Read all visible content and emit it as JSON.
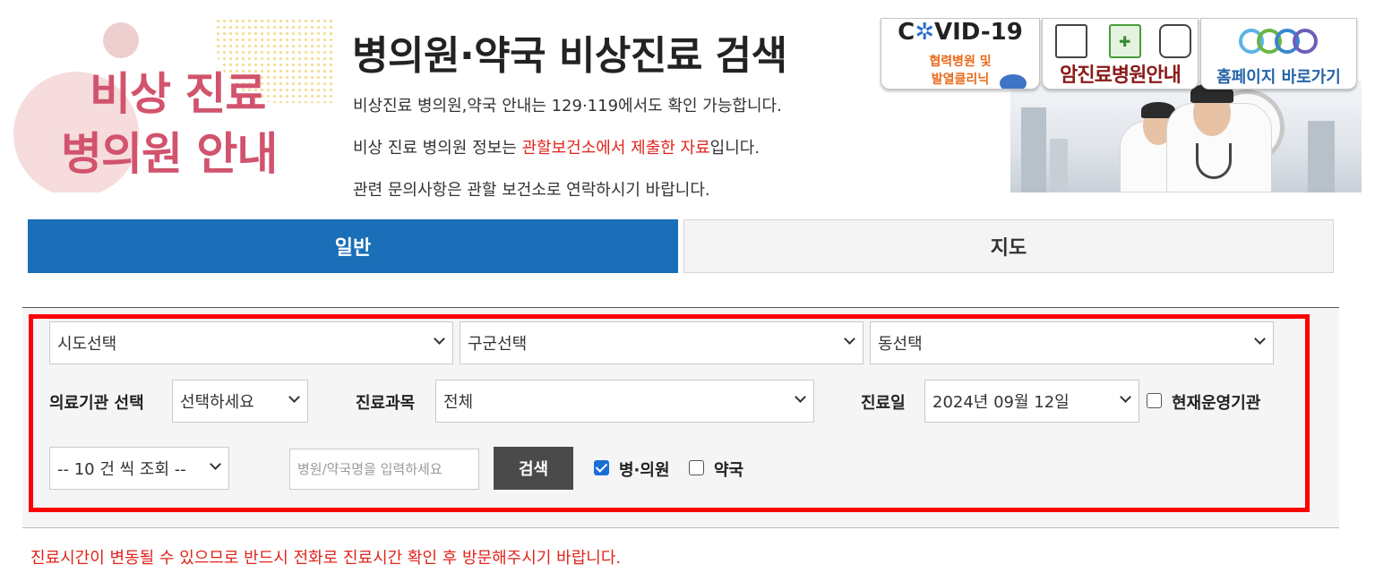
{
  "header": {
    "logo_line1": "비상 진료",
    "logo_line2": "병의원 안내",
    "title": "병의원·약국 비상진료 검색",
    "info1": "비상진료 병의원,약국 안내는 129·119에서도 확인 가능합니다.",
    "info2_prefix": "비상 진료 병의원 정보는 ",
    "info2_highlight": "관할보건소에서 제출한 자료",
    "info2_suffix": "입니다.",
    "info3": "관련 문의사항은 관할 보건소로 연락하시기 바랍니다."
  },
  "banner": {
    "covid_title_c": "C",
    "covid_title_virus": "✲",
    "covid_title_rest": "VID-19",
    "covid_sub1": "협력병원 및",
    "covid_sub2": "발열클리닉",
    "cancer_label": "암진료병원안내",
    "home_label": "홈페이지 바로가기"
  },
  "tabs": [
    {
      "label": "일반",
      "active": true
    },
    {
      "label": "지도",
      "active": false
    }
  ],
  "filters": {
    "sido": "시도선택",
    "gugun": "구군선택",
    "dong": "동선택",
    "institution_label": "의료기관 선택",
    "institution_value": "선택하세요",
    "department_label": "진료과목",
    "department_value": "전체",
    "date_label": "진료일",
    "date_value": "2024년 09월 12일",
    "operating_label": "현재운영기관",
    "operating_checked": false,
    "page_size_value": "-- 10 건 씩 조회 --",
    "name_placeholder": "병원/약국명을 입력하세요",
    "search_label": "검색",
    "hospital_label": "병·의원",
    "hospital_checked": true,
    "pharmacy_label": "약국",
    "pharmacy_checked": false
  },
  "notice": "진료시간이 변동될 수 있으므로 반드시 전화로 진료시간 확인 후 방문해주시기 바랍니다.",
  "colors": {
    "tab_active": "#1a6fb8",
    "highlight_border": "#ff0000",
    "notice_text": "#e0241b",
    "logo_text": "#d2536d"
  }
}
